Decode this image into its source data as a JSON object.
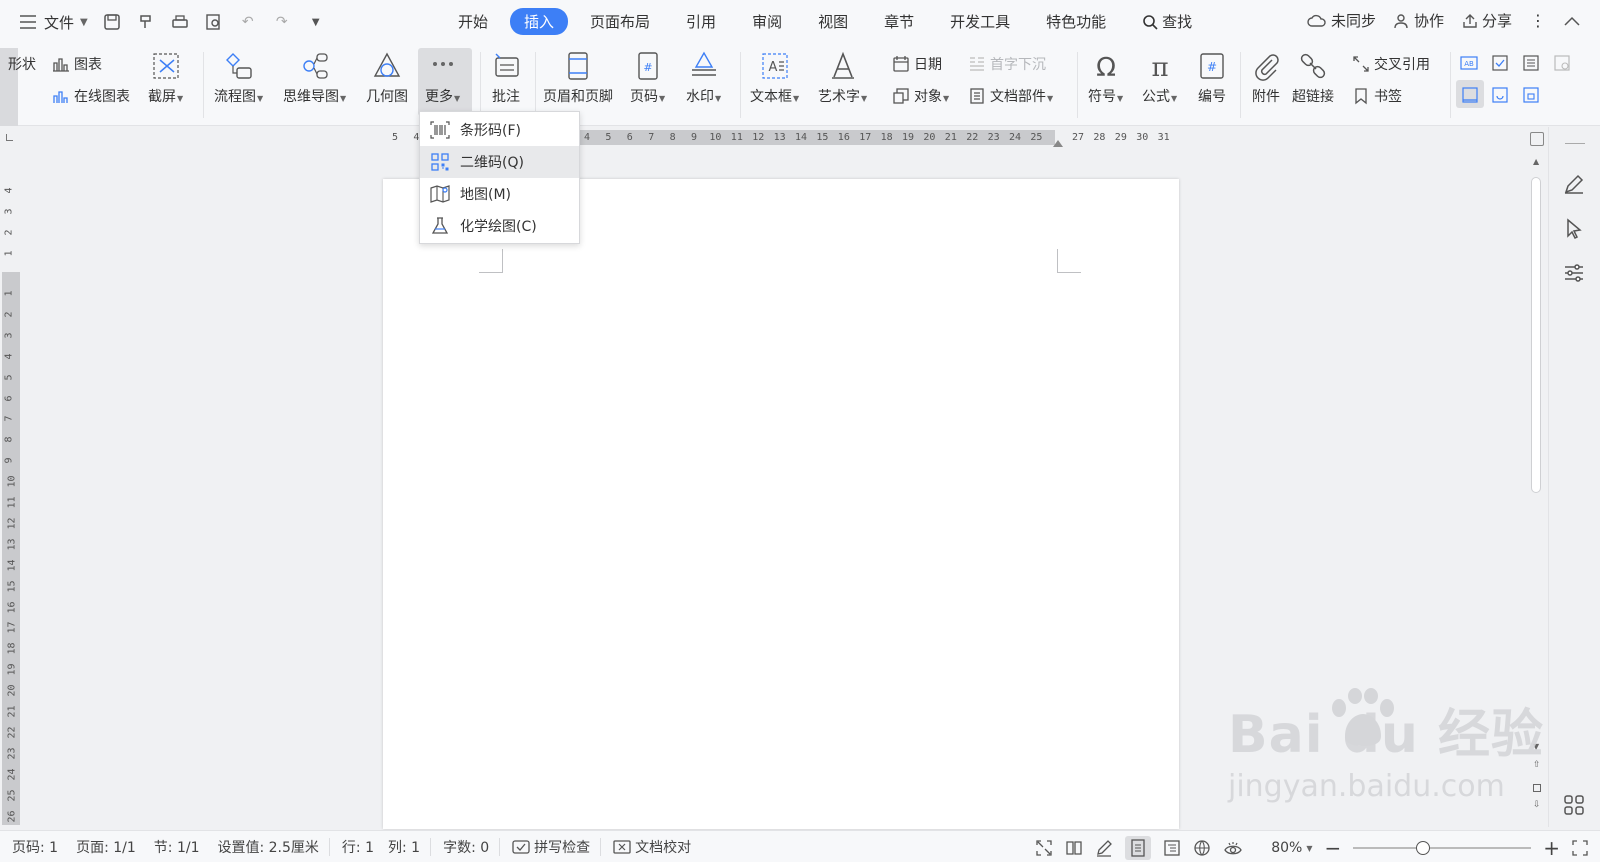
{
  "titlebar": {
    "file_label": "文件",
    "tabs": [
      "开始",
      "插入",
      "页面布局",
      "引用",
      "审阅",
      "视图",
      "章节",
      "开发工具",
      "特色功能"
    ],
    "active_tab": "插入",
    "search_label": "查找",
    "unsynced_label": "未同步",
    "collab_label": "协作",
    "share_label": "分享"
  },
  "ribbon": {
    "shape_label": "形状",
    "chart_label": "图表",
    "online_chart_label": "在线图表",
    "screenshot_label": "截屏",
    "flowchart_label": "流程图",
    "mindmap_label": "思维导图",
    "geometry_label": "几何图",
    "more_label": "更多",
    "comment_label": "批注",
    "header_footer_label": "页眉和页脚",
    "page_number_label": "页码",
    "watermark_label": "水印",
    "textbox_label": "文本框",
    "wordart_label": "艺术字",
    "date_label": "日期",
    "object_label": "对象",
    "dropcap_label": "首字下沉",
    "docparts_label": "文档部件",
    "symbol_label": "符号",
    "formula_label": "公式",
    "numbering_label": "编号",
    "attachment_label": "附件",
    "hyperlink_label": "超链接",
    "crossref_label": "交叉引用",
    "bookmark_label": "书签"
  },
  "dropdown": {
    "items": [
      {
        "label": "条形码(F)",
        "icon": "barcode-icon"
      },
      {
        "label": "二维码(Q)",
        "icon": "qrcode-icon"
      },
      {
        "label": "地图(M)",
        "icon": "map-icon"
      },
      {
        "label": "化学绘图(C)",
        "icon": "flask-icon"
      }
    ]
  },
  "ruler": {
    "h_left": [
      "5",
      "4"
    ],
    "h_main": [
      "4",
      "5",
      "6",
      "7",
      "8",
      "9",
      "10",
      "11",
      "12",
      "13",
      "14",
      "15",
      "16",
      "17",
      "18",
      "19",
      "20",
      "21",
      "22",
      "23",
      "24",
      "25"
    ],
    "h_right": [
      "27",
      "28",
      "29",
      "30",
      "31"
    ],
    "v_top": [
      "4",
      "3",
      "2",
      "1"
    ],
    "v_main": [
      "1",
      "2",
      "3",
      "4",
      "5",
      "6",
      "7",
      "8",
      "9",
      "10",
      "11",
      "12",
      "13",
      "14",
      "15",
      "16",
      "17",
      "18",
      "19",
      "20",
      "21",
      "22",
      "23",
      "24",
      "25",
      "26"
    ]
  },
  "statusbar": {
    "page_code": "页码: 1",
    "page": "页面: 1/1",
    "section": "节: 1/1",
    "setting": "设置值: 2.5厘米",
    "row": "行: 1",
    "col": "列: 1",
    "word_count": "字数: 0",
    "spell_check": "拼写检查",
    "doc_proof": "文档校对",
    "zoom": "80%"
  },
  "watermark": {
    "brand": "Bai du 经验",
    "url": "jingyan.baidu.com"
  },
  "colors": {
    "accent": "#3d7ff6"
  }
}
